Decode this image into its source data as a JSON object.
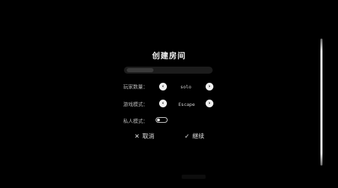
{
  "dialog": {
    "title": "创建房间",
    "room_name": {
      "value": "",
      "placeholder": ""
    },
    "player_count": {
      "label": "玩家数量：",
      "value": "solo",
      "prev_icon": "chevron-left-icon",
      "next_icon": "chevron-right-icon"
    },
    "game_mode": {
      "label": "游戏模式：",
      "value": "Escape",
      "prev_icon": "chevron-left-icon",
      "next_icon": "chevron-right-icon"
    },
    "private_mode": {
      "label": "私人模式：",
      "enabled": false
    },
    "cancel": {
      "icon": "close-icon",
      "glyph": "✕",
      "label": "取消"
    },
    "continue": {
      "icon": "check-icon",
      "glyph": "✓",
      "label": "继续"
    }
  },
  "colors": {
    "background": "#000000",
    "text": "#e6e6e6",
    "button": "#f0f0f0"
  }
}
